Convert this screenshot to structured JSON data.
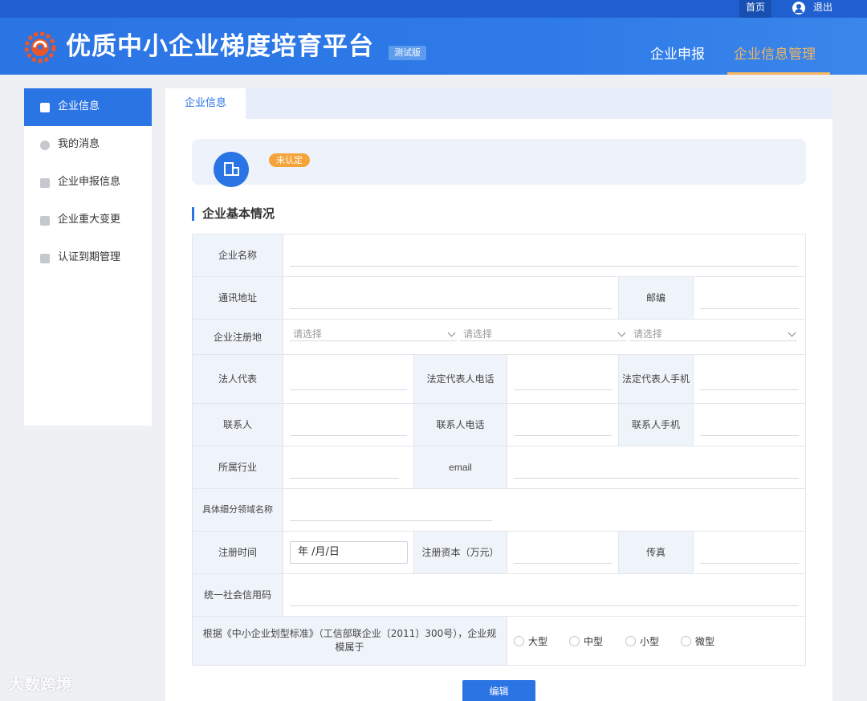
{
  "topbar": {
    "home": "首页",
    "logout": "退出"
  },
  "header": {
    "title": "优质中小企业梯度培育平台",
    "beta": "测试版",
    "nav": [
      {
        "label": "企业申报"
      },
      {
        "label": "企业信息管理"
      }
    ]
  },
  "sidebar": {
    "items": [
      {
        "label": "企业信息",
        "active": true
      },
      {
        "label": "我的消息"
      },
      {
        "label": "企业申报信息"
      },
      {
        "label": "企业重大变更"
      },
      {
        "label": "认证到期管理"
      }
    ]
  },
  "main": {
    "tab": "企业信息",
    "status": "未认定",
    "section_title": "企业基本情况",
    "form": {
      "company_name": "企业名称",
      "address": "通讯地址",
      "postcode": "邮编",
      "reg_place": "企业注册地",
      "select_placeholder": "请选择",
      "legal_rep": "法人代表",
      "legal_rep_phone": "法定代表人电话",
      "legal_rep_mobile": "法定代表人手机",
      "contact": "联系人",
      "contact_phone": "联系人电话",
      "contact_mobile": "联系人手机",
      "industry": "所属行业",
      "email": "email",
      "subfield": "具体细分领域名称",
      "reg_time": "注册时间",
      "date_value": "年 /月/日",
      "reg_capital": "注册资本（万元）",
      "fax": "传真",
      "credit_code": "统一社会信用码",
      "size_question": "根据《中小企业划型标准》（工信部联企业〔2011〕300号），企业规模属于",
      "size_options": [
        "大型",
        "中型",
        "小型",
        "微型"
      ]
    },
    "edit_button": "编辑"
  },
  "watermark": "大数跨境",
  "colors": {
    "primary": "#2b74e4",
    "accent": "#f3b661",
    "badge": "#f5a43a"
  }
}
